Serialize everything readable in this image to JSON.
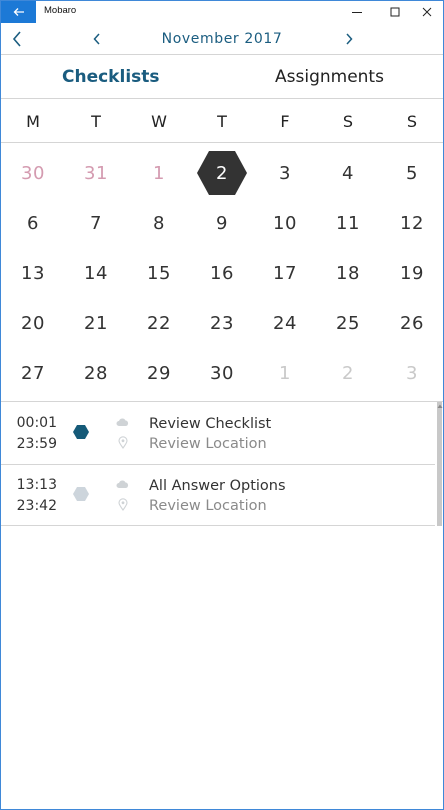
{
  "window": {
    "title": "Mobaro",
    "accent": "#1c79d6"
  },
  "icons": {
    "back": "back-arrow-icon",
    "minimize": "minimize-icon",
    "maximize": "maximize-icon",
    "close": "close-icon"
  },
  "nav": {
    "month": "November 2017"
  },
  "tabs": {
    "checklists": "Checklists",
    "assignments": "Assignments"
  },
  "calendar": {
    "weekdays": [
      "M",
      "T",
      "W",
      "T",
      "F",
      "S",
      "S"
    ],
    "weeks": [
      [
        "30",
        "31",
        "1",
        "2",
        "3",
        "4",
        "5"
      ],
      [
        "6",
        "7",
        "8",
        "9",
        "10",
        "11",
        "12"
      ],
      [
        "13",
        "14",
        "15",
        "16",
        "17",
        "18",
        "19"
      ],
      [
        "20",
        "21",
        "22",
        "23",
        "24",
        "25",
        "26"
      ],
      [
        "27",
        "28",
        "29",
        "30",
        "1",
        "2",
        "3"
      ]
    ],
    "selected_day": "2",
    "colors": {
      "prev_month": "#d49bb0",
      "next_month": "#c9c9c9",
      "selected_bg": "#333333"
    }
  },
  "items": [
    {
      "start": "00:01",
      "end": "23:59",
      "title": "Review Checklist",
      "location": "Review Location",
      "status_color": "#155a78"
    },
    {
      "start": "13:13",
      "end": "23:42",
      "title": "All Answer Options",
      "location": "Review Location",
      "status_color": "#cdd5dc"
    }
  ]
}
